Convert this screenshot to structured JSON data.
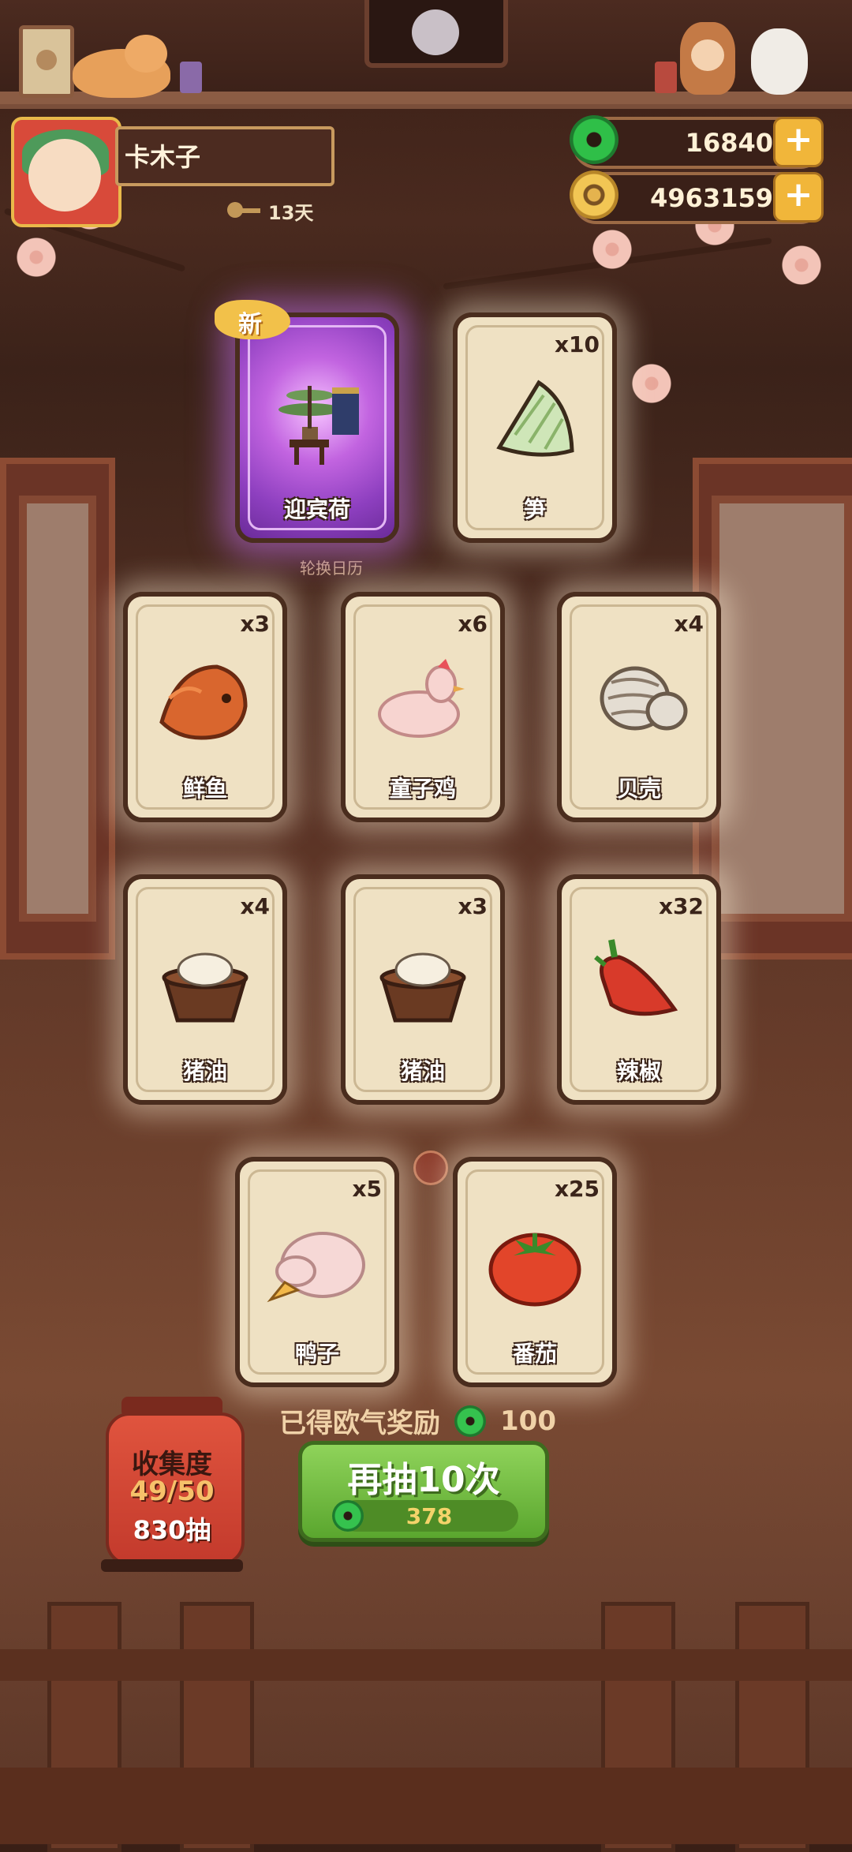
{
  "player": {
    "name": "卡木子",
    "days": "13天"
  },
  "currency": {
    "jade": "16840",
    "coins": "4963159"
  },
  "rotate_label": "轮换日历",
  "cards": [
    {
      "name": "迎宾荷",
      "count": "",
      "is_new": true,
      "new_label": "新",
      "rarity": "rare",
      "icon": "bonsai-altar-icon"
    },
    {
      "name": "笋",
      "count": "x10",
      "is_new": false,
      "icon": "bamboo-shoot-icon"
    },
    {
      "name": "鲜鱼",
      "count": "x3",
      "is_new": false,
      "icon": "fish-icon"
    },
    {
      "name": "童子鸡",
      "count": "x6",
      "is_new": false,
      "icon": "chicken-icon"
    },
    {
      "name": "贝壳",
      "count": "x4",
      "is_new": false,
      "icon": "clam-icon"
    },
    {
      "name": "猪油",
      "count": "x4",
      "is_new": false,
      "icon": "lard-icon"
    },
    {
      "name": "猪油",
      "count": "x3",
      "is_new": false,
      "icon": "lard-icon"
    },
    {
      "name": "辣椒",
      "count": "x32",
      "is_new": false,
      "icon": "chili-icon"
    },
    {
      "name": "鸭子",
      "count": "x5",
      "is_new": false,
      "icon": "duck-icon"
    },
    {
      "name": "番茄",
      "count": "x25",
      "is_new": false,
      "icon": "tomato-icon"
    }
  ],
  "bonus": {
    "label": "已得欧气奖励",
    "value": "100"
  },
  "collection": {
    "title": "收集度",
    "progress": "49/50",
    "draws": "830抽"
  },
  "draw_button": {
    "label": "再抽10次",
    "cost": "378"
  },
  "colors": {
    "card_bg": "#efe1c3",
    "rare_glow": "#c264e0",
    "button_green": "#5aa62e",
    "jade_green": "#2fbf48",
    "coin_gold": "#f2c654"
  }
}
